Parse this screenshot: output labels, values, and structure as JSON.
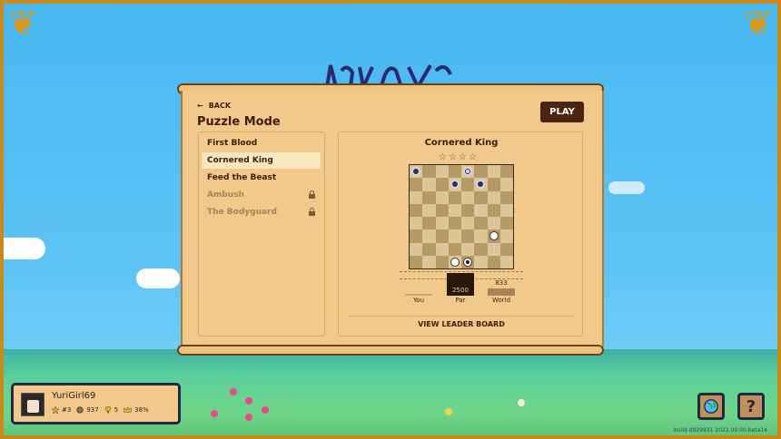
{
  "header": {
    "back_label": "BACK",
    "title": "Puzzle Mode",
    "play_label": "PLAY"
  },
  "levels": [
    {
      "name": "First Blood",
      "locked": false,
      "selected": false
    },
    {
      "name": "Cornered King",
      "locked": false,
      "selected": true
    },
    {
      "name": "Feed the Beast",
      "locked": false,
      "selected": false
    },
    {
      "name": "Ambush",
      "locked": true,
      "selected": false
    },
    {
      "name": "The Bodyguard",
      "locked": true,
      "selected": false
    }
  ],
  "detail": {
    "title": "Cornered King",
    "stars_total": 4,
    "stars_earned": 0,
    "board": {
      "size": 8,
      "pieces": [
        {
          "row": 0,
          "col": 0,
          "color": "black",
          "king": false
        },
        {
          "row": 0,
          "col": 4,
          "color": "black",
          "king": true
        },
        {
          "row": 1,
          "col": 3,
          "color": "black",
          "king": false
        },
        {
          "row": 1,
          "col": 5,
          "color": "black",
          "king": false
        },
        {
          "row": 5,
          "col": 6,
          "color": "white",
          "king": false
        },
        {
          "row": 7,
          "col": 3,
          "color": "white",
          "king": false
        },
        {
          "row": 7,
          "col": 4,
          "color": "white",
          "king": true
        }
      ]
    },
    "scores": [
      {
        "label": "You",
        "value": null,
        "display": ""
      },
      {
        "label": "Par",
        "value": 2500,
        "display": "2500"
      },
      {
        "label": "World",
        "value": 833,
        "display": "833"
      }
    ],
    "leaderboard_label": "VIEW LEADER BOARD"
  },
  "player": {
    "name": "YuriGirl69",
    "stats": [
      {
        "icon": "star-icon",
        "value": "#3"
      },
      {
        "icon": "coin-icon",
        "value": "937"
      },
      {
        "icon": "trophy-icon",
        "value": "5"
      },
      {
        "icon": "crown-icon",
        "value": "38%"
      }
    ]
  },
  "build_text": "build d929931 2022.09.00-beta14",
  "colors": {
    "panel": "#f0c98b",
    "dark": "#4a2512",
    "light_square": "#dcc597",
    "dark_square": "#b59a64",
    "sky": "#4fbdf2"
  }
}
